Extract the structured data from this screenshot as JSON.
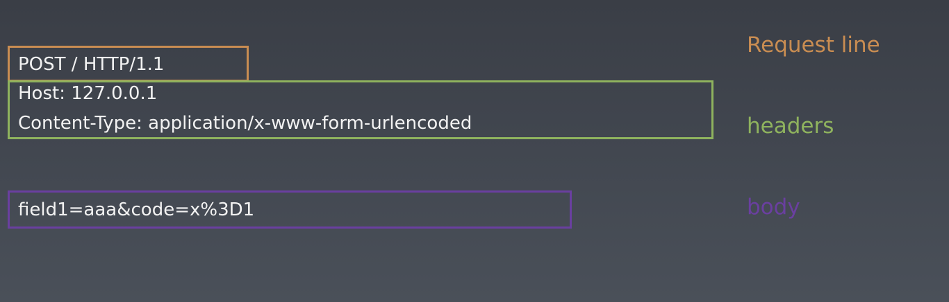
{
  "request": {
    "line": "POST / HTTP/1.1",
    "label": "Request line",
    "color": "#c98d52"
  },
  "headers": {
    "lines": [
      "Host: 127.0.0.1",
      "Content-Type: application/x-www-form-urlencoded"
    ],
    "label": "headers",
    "color": "#8fb35e"
  },
  "body": {
    "line": "field1=aaa&code=x%3D1",
    "label": "body",
    "color": "#6a3fa0"
  }
}
